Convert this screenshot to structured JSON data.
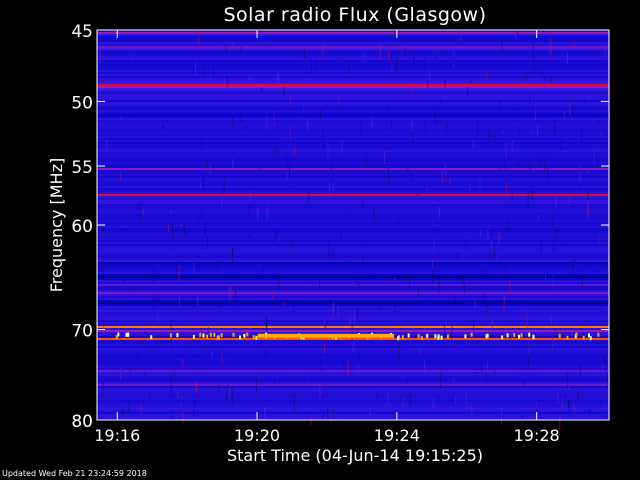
{
  "chart_data": {
    "type": "heatmap",
    "title": "Solar radio Flux (Glasgow)",
    "xlabel": "Start Time (04-Jun-14 19:15:25)",
    "ylabel": "Frequency [MHz]",
    "x_ticks": [
      "19:16",
      "19:20",
      "19:24",
      "19:28"
    ],
    "x_tick_minutes": [
      0.58,
      4.58,
      8.58,
      12.58
    ],
    "xlim_minutes": [
      0,
      14.65
    ],
    "y_ticks": [
      45,
      50,
      55,
      60,
      70,
      80
    ],
    "ylim": [
      45,
      80
    ],
    "y_scale": "log",
    "y_inverted": true,
    "colormap": [
      "#00004a",
      "#0000c8",
      "#3a18e0",
      "#9a1ab0",
      "#ff0000",
      "#ffcc00",
      "#ffffc8"
    ],
    "features": [
      {
        "freq": 48.8,
        "width": 0.18,
        "level": 0.62
      },
      {
        "freq": 49.0,
        "width": 0.12,
        "level": 0.66
      },
      {
        "freq": 45.2,
        "width": 0.1,
        "level": 0.5
      },
      {
        "freq": 46.2,
        "width": 0.12,
        "level": 0.5
      },
      {
        "freq": 51.0,
        "width": 0.2,
        "level": 0.18
      },
      {
        "freq": 55.2,
        "width": 0.12,
        "level": 0.58
      },
      {
        "freq": 57.4,
        "width": 0.14,
        "level": 0.62
      },
      {
        "freq": 58.0,
        "width": 0.1,
        "level": 0.45
      },
      {
        "freq": 63.5,
        "width": 0.22,
        "level": 0.1
      },
      {
        "freq": 64.8,
        "width": 0.3,
        "level": 0.06
      },
      {
        "freq": 65.6,
        "width": 0.1,
        "level": 0.48
      },
      {
        "freq": 66.3,
        "width": 0.12,
        "level": 0.5
      },
      {
        "freq": 67.3,
        "width": 0.3,
        "level": 0.08
      },
      {
        "freq": 69.7,
        "width": 0.15,
        "level": 0.98
      },
      {
        "freq": 70.2,
        "width": 0.1,
        "level": 0.68
      },
      {
        "freq": 71.0,
        "width": 0.12,
        "level": 0.78
      },
      {
        "freq": 74.5,
        "width": 0.16,
        "level": 0.55
      },
      {
        "freq": 76.0,
        "width": 0.12,
        "level": 0.45
      },
      {
        "freq": 78.8,
        "width": 0.14,
        "level": 0.42
      }
    ]
  },
  "footer": "Updated Wed Feb 21 23:24:59 2018"
}
